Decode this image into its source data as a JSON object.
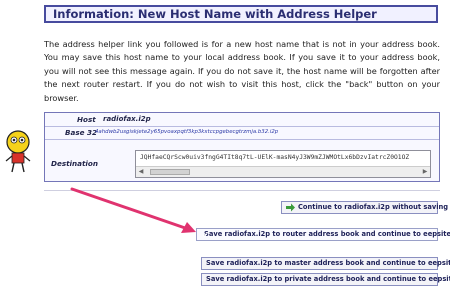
{
  "header": {
    "title": "Information: New Host Name with Address Helper"
  },
  "message": "The address helper link you followed is for a new host name that is not in your address book. You may save this host name to your local address book. If you save it to your address book, you will not see this message again. If you do not save it, the host name will be forgotten after the next router restart. If you do not wish to visit this host, click the \"back\" button on your browser.",
  "details": {
    "host_label": "Host",
    "host_value": "radiofax.i2p",
    "base32_label": "Base 32",
    "base32_value": "4ahdwb2usgiskjete2y65pvoaxpqtf3kp3kxtccpgebecgtrzmja.b32.i2p",
    "destination_label": "Destination",
    "destination_value": "JQHfaeCQrScw0uiv3fngG4TIt8q7tL-UElK-masN4yJ3W9mZJWMOtLx6bDzvIatrcZ0O1OZ"
  },
  "buttons": {
    "continue_without_saving": "Continue to radiofax.i2p without saving",
    "save_router": "Save radiofax.i2p to router address book and continue to eepsite",
    "save_master": "Save radiofax.i2p to master address book and continue to eepsite",
    "save_private": "Save radiofax.i2p to private address book and continue to eepsite"
  },
  "colors": {
    "header_border": "#474b9e",
    "arrow": "#e0336f",
    "check": "#3a9b3a"
  }
}
